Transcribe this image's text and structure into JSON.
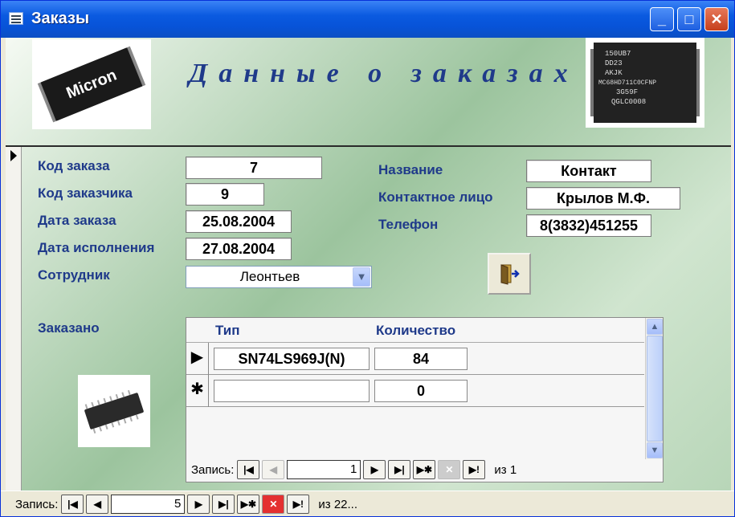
{
  "window": {
    "title": "Заказы"
  },
  "header": {
    "title": "Данные о заказах"
  },
  "fields": {
    "order_code": {
      "label": "Код заказа",
      "value": "7"
    },
    "customer_code": {
      "label": "Код заказчика",
      "value": "9"
    },
    "order_date": {
      "label": "Дата заказа",
      "value": "25.08.2004"
    },
    "completion_date": {
      "label": "Дата исполнения",
      "value": "27.08.2004"
    },
    "employee": {
      "label": "Сотрудник",
      "value": "Леонтьев"
    },
    "name": {
      "label": "Название",
      "value": "Контакт"
    },
    "contact_person": {
      "label": "Контактное лицо",
      "value": "Крылов М.Ф."
    },
    "phone": {
      "label": "Телефон",
      "value": "8(3832)451255"
    }
  },
  "subform": {
    "label": "Заказано",
    "columns": [
      "Тип",
      "Количество"
    ],
    "rows": [
      {
        "type": "SN74LS969J(N)",
        "qty": "84"
      },
      {
        "type": "",
        "qty": "0"
      }
    ],
    "nav": {
      "label": "Запись:",
      "position": "1",
      "of": "из  1"
    }
  },
  "main_nav": {
    "label": "Запись:",
    "position": "5",
    "of": "из 22..."
  },
  "images": {
    "chip1_text": "Micron",
    "chip2_lines": [
      "150UB7",
      "DD23",
      "AKJK",
      "MC68HD711C0CFNP",
      "3G59F",
      "QGLC0008"
    ]
  },
  "icons": [
    "window-icon",
    "minimize-icon",
    "maximize-icon",
    "close-icon",
    "dropdown-arrow-icon",
    "exit-door-icon",
    "record-selector-icon",
    "new-record-icon",
    "scroll-up-icon",
    "scroll-down-icon",
    "first-record-icon",
    "prev-record-icon",
    "next-record-icon",
    "last-record-icon",
    "new-record-nav-icon",
    "delete-record-icon",
    "last-modified-icon"
  ],
  "colors": {
    "label": "#1f3a8a",
    "titlebar": "#0a5ae0",
    "form_bg": "#9cc49e"
  }
}
